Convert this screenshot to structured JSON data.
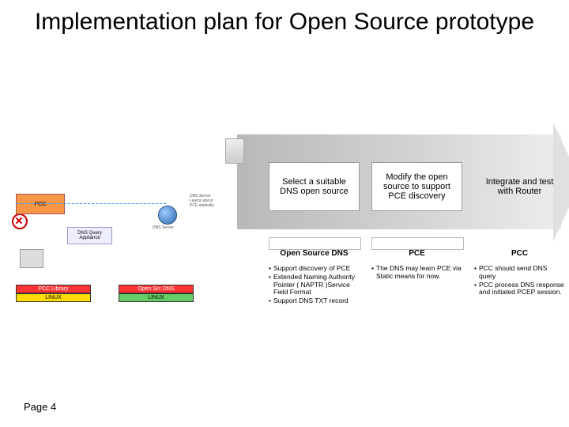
{
  "title": "Implementation plan for Open Source prototype",
  "page_label": "Page 4",
  "phases": {
    "p1": {
      "heading": "Select a suitable DNS open source",
      "label": "Open Source DNS",
      "bullets": [
        "Support discovery of PCE",
        "Extended Naming Authority Pointer ( NAPTR )Service Field Format",
        "Support DNS TXT record"
      ]
    },
    "p2": {
      "heading": "Modify the open source to support PCE discovery",
      "label": "PCE",
      "bullets": [
        "The DNS may learn PCE via Static means for now."
      ]
    },
    "p3": {
      "heading": "Integrate and test with Router",
      "label": "PCC",
      "bullets": [
        "PCC should send DNS query",
        "PCC process DNS response and initiated PCEP session."
      ]
    }
  },
  "diagram": {
    "pcc": "PCC",
    "dns_query": "DNS Query Appliance",
    "dns_server": "DNS Server",
    "stackA": {
      "top": "PCC Library",
      "bottom": "LINUX"
    },
    "stackB": {
      "top": "Open Src DNS",
      "bottom": "LINUX"
    },
    "pce_note": "DNS Server Learns about PCE statically"
  }
}
